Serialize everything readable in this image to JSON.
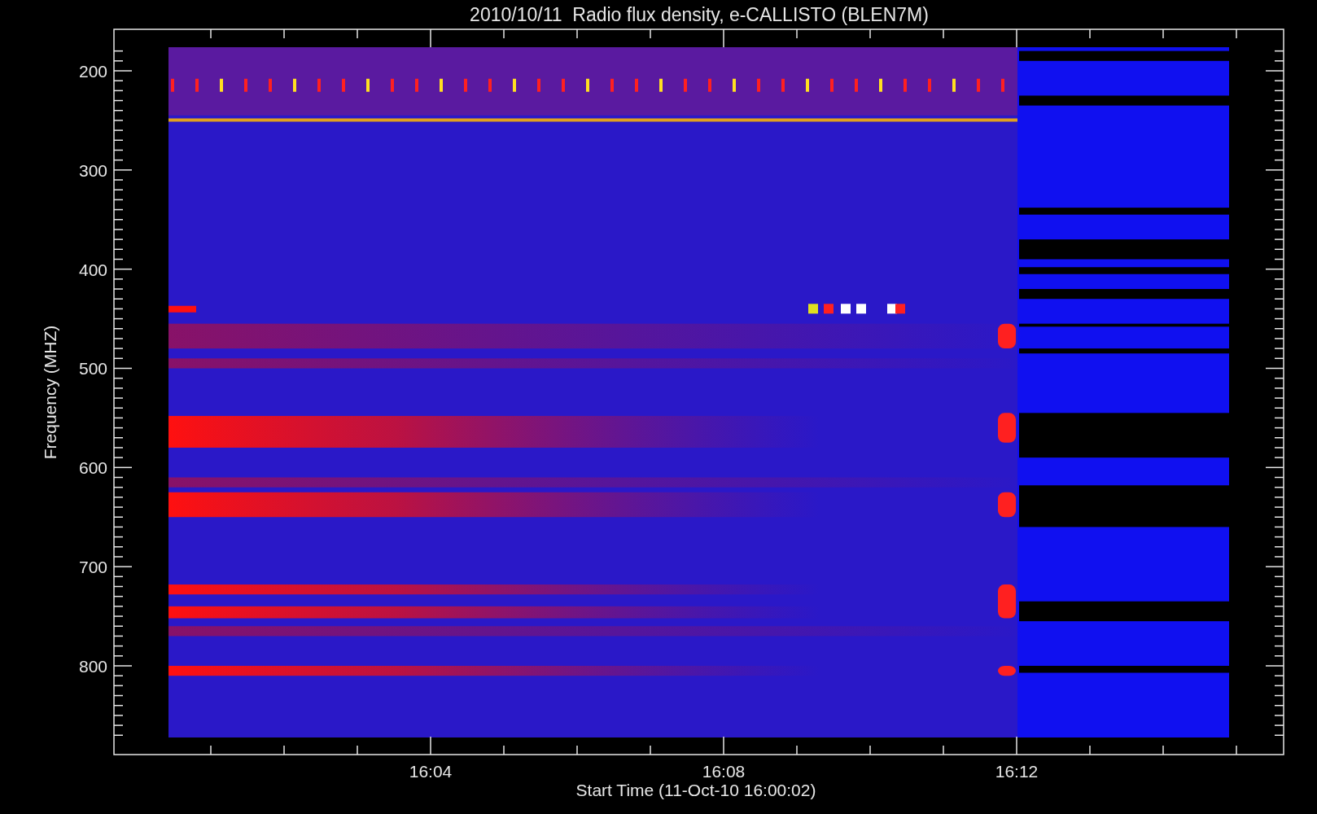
{
  "title": "2010/10/11  Radio flux density, e-CALLISTO (BLEN7M)",
  "xlabel": "Start Time (11-Oct-10 16:00:02)",
  "ylabel": "Frequency (MHZ)",
  "xticks": [
    {
      "label": "16:04"
    },
    {
      "label": "16:08"
    },
    {
      "label": "16:12"
    }
  ],
  "yticks": [
    {
      "label": "200"
    },
    {
      "label": "300"
    },
    {
      "label": "400"
    },
    {
      "label": "500"
    },
    {
      "label": "600"
    },
    {
      "label": "700"
    },
    {
      "label": "800"
    }
  ]
}
